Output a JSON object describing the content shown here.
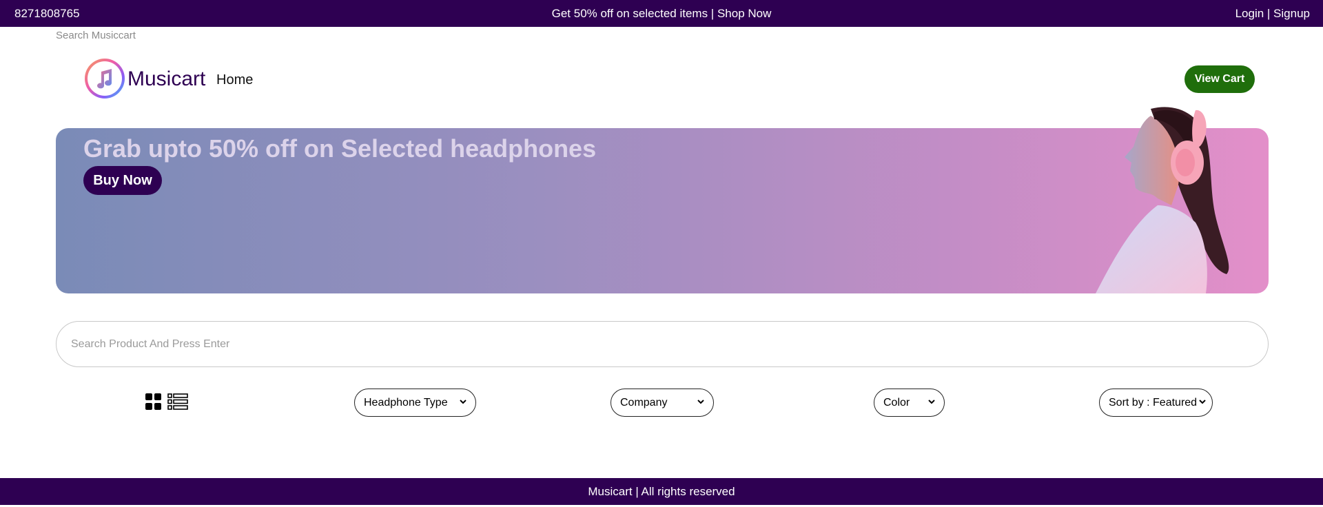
{
  "topbar": {
    "phone": "8271808765",
    "promo": "Get 50% off on selected items | Shop Now",
    "auth": "Login | Signup"
  },
  "header": {
    "search_brand": "Search Musiccart",
    "brand": "Musicart",
    "home": "Home",
    "view_cart": "View Cart"
  },
  "banner": {
    "title": "Grab upto 50% off on Selected headphones",
    "cta": "Buy Now"
  },
  "search": {
    "placeholder": "Search Product And Press Enter"
  },
  "filters": {
    "headphone_type": "Headphone Type",
    "company": "Company",
    "color": "Color",
    "sort": "Sort by : Featured"
  },
  "footer": {
    "text": "Musicart | All rights reserved"
  },
  "colors": {
    "brand_purple": "#2e0052",
    "cart_green": "#1f6e0b"
  },
  "icons": [
    "music-note-icon",
    "grid-view-icon",
    "list-view-icon",
    "chevron-down-icon"
  ]
}
